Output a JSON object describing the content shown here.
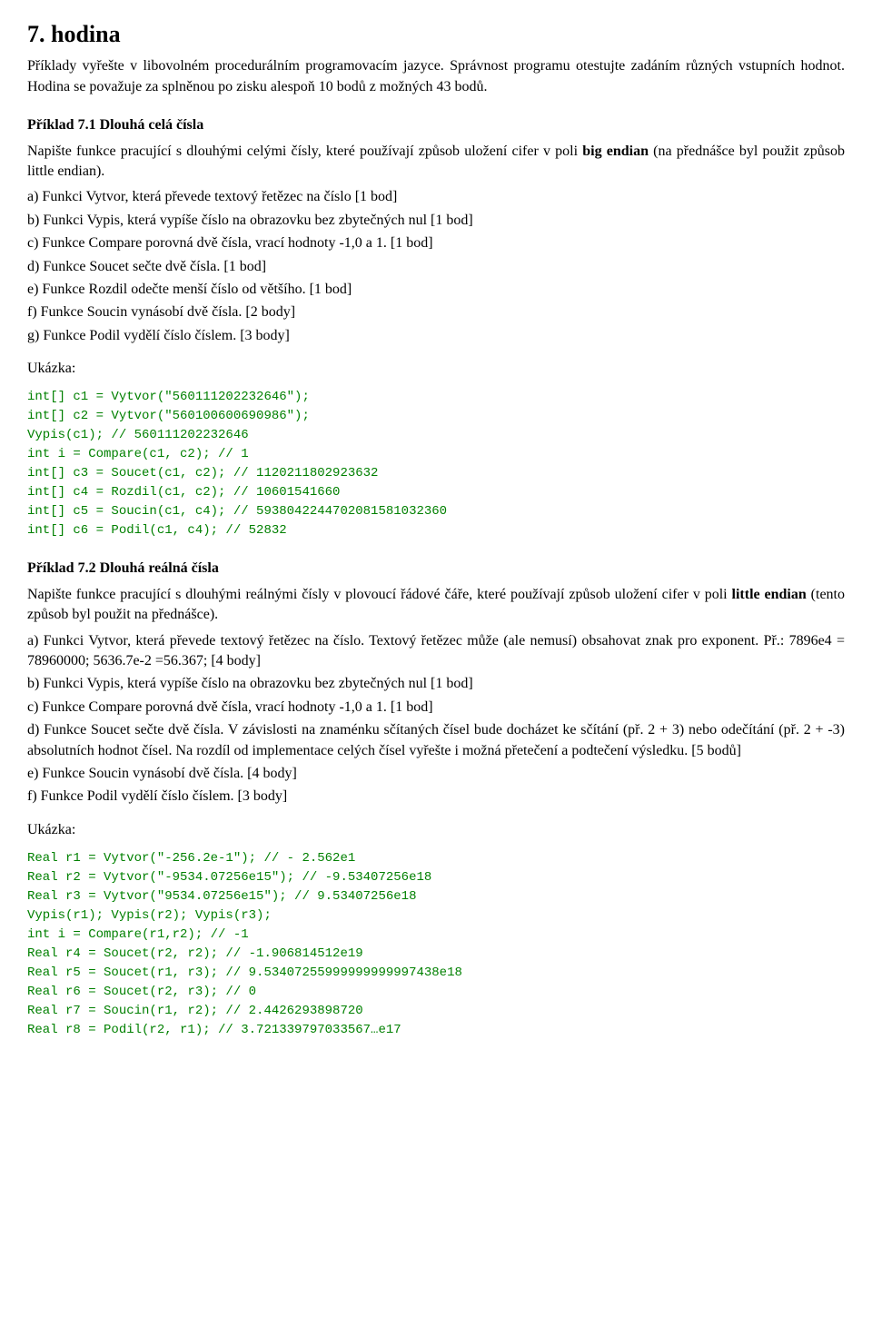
{
  "page": {
    "title": "7. hodina",
    "intro": [
      "Příklady vyřešte v libovolném procedurálním programovacím jazyce. Správnost programu otestujte zadáním různých vstupních hodnot. Hodina se považuje za splněnou po zisku alespoň 10 bodů z možných 43 bodů."
    ],
    "example1": {
      "title": "Příklad 7.1 Dlouhá celá čísla",
      "description": "Napište funkce pracující s dlouhými celými čísly, které používají způsob uložení cifer v poli big endian (na přednášce byl použit způsob little endian).",
      "items": [
        "a) Funkci Vytvor, která převede textový řetězec na číslo [1 bod]",
        "b) Funkci Vypis, která vypíše číslo na obrazovku bez zbytečných nul [1 bod]",
        "c) Funkce Compare porovná dvě čísla, vrací hodnoty -1,0 a 1. [1 bod]",
        "d) Funkce Soucet sečte dvě čísla. [1 bod]",
        "e) Funkce Rozdil odečte menší číslo od většího. [1 bod]",
        "f) Funkce Soucin vynásobí dvě čísla. [2 body]",
        "g) Funkce Podil vydělí číslo číslem. [3 body]"
      ],
      "ukazka_label": "Ukázka:",
      "code": "int[] c1 = Vytvor(\"560111202232646\");\nint[] c2 = Vytvor(\"560100600690986\");\nVypis(c1); // 560111202232646\nint i = Compare(c1, c2); // 1\nint[] c3 = Soucet(c1, c2); // 1120211802923632\nint[] c4 = Rozdil(c1, c2); // 10601541660\nint[] c5 = Soucin(c1, c4); // 5938042244702081581032360\nint[] c6 = Podil(c1, c4); // 52832"
    },
    "example2": {
      "title": "Příklad 7.2 Dlouhá reálná čísla",
      "description1": "Napište funkce pracující s dlouhými reálnými čísly v plovoucí řádové čáře, které používají způsob uložení cifer v poli",
      "bold1": "little endian",
      "description2": "(tento způsob byl použit na přednášce).",
      "items": [
        "a) Funkci Vytvor, která převede textový řetězec na číslo. Textový řetězec může (ale nemusí) obsahovat znak pro exponent. Př.: 7896e4 = 78960000; 5636.7e-2 =56.367; [4 body]",
        "b) Funkci Vypis, která vypíše číslo na obrazovku bez zbytečných nul  [1 bod]",
        "c) Funkce Compare porovná dvě čísla, vrací hodnoty -1,0 a 1. [1 bod]",
        "d) Funkce Soucet sečte dvě čísla. V závislosti na znaménku sčítaných čísel bude docházet ke sčítání (př. 2 + 3) nebo odečítání (př. 2 + -3) absolutních hodnot čísel. Na rozdíl od implementace celých čísel vyřešte i možná přetečení a podtečení výsledku. [5 bodů]",
        "e) Funkce Soucin vynásobí dvě čísla. [4 body]",
        "f) Funkce Podil vydělí číslo číslem. [3 body]"
      ],
      "ukazka_label": "Ukázka:",
      "code": "Real r1 = Vytvor(\"-256.2e-1\"); // - 2.562e1\nReal r2 = Vytvor(\"-9534.07256e15\"); // -9.53407256e18\nReal r3 = Vytvor(\"9534.07256e15\"); // 9.53407256e18\nVypis(r1); Vypis(r2); Vypis(r3);\nint i = Compare(r1,r2); // -1\nReal r4 = Soucet(r2, r2); // -1.906814512e19\nReal r5 = Soucet(r1, r3); // 9.53407255999999999997438e18\nReal r6 = Soucet(r2, r3); // 0\nReal r7 = Soucin(r1, r2); // 2.4426293898720\nReal r8 = Podil(r2, r1); // 3.721339797033567…e17"
    }
  }
}
